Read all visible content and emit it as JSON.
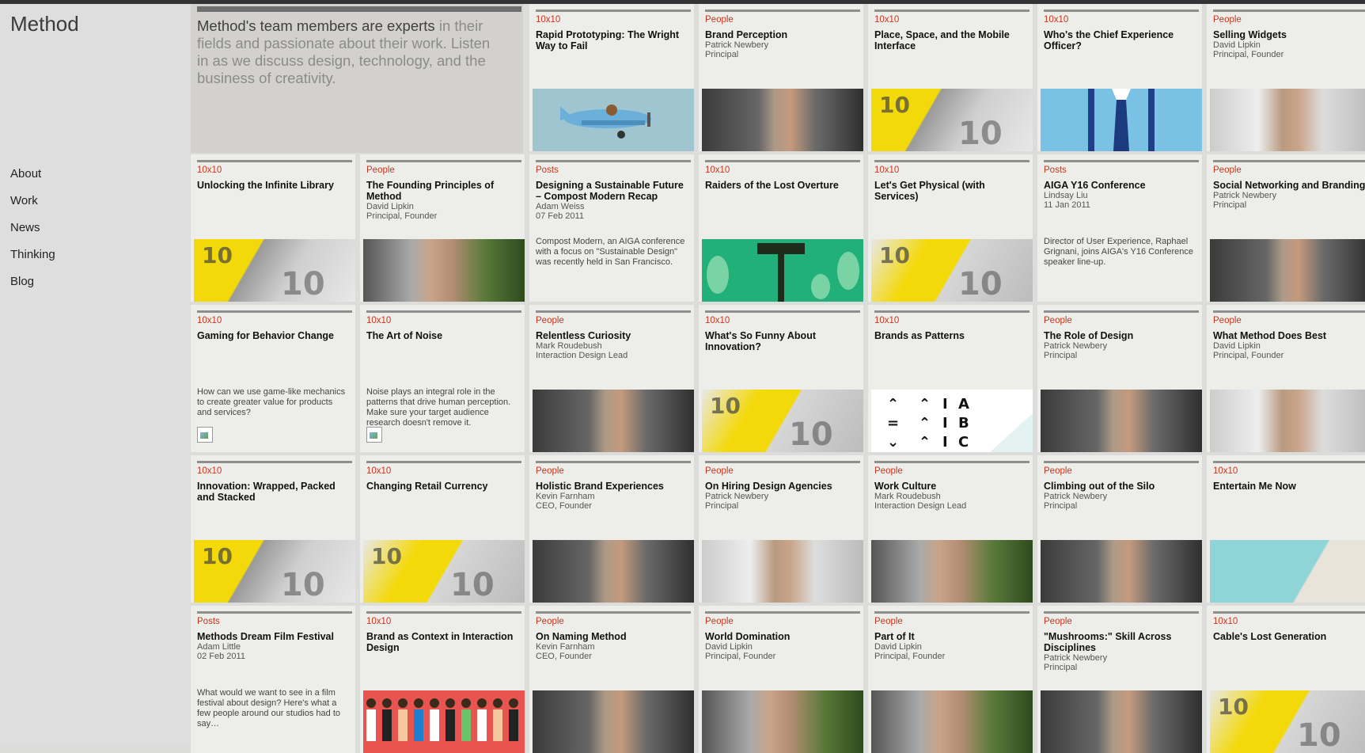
{
  "site": {
    "logo": "Method"
  },
  "nav": [
    {
      "label": "About"
    },
    {
      "label": "Work"
    },
    {
      "label": "News"
    },
    {
      "label": "Thinking"
    },
    {
      "label": "Blog"
    }
  ],
  "intro": {
    "strong": "Method's team members are experts",
    "rest": " in their fields and passionate about their work. Listen in as we discuss design, technology, and the business of creativity."
  },
  "tiles": [
    {
      "category": "10x10",
      "title": "Rapid Prototyping: The Wright Way to Fail",
      "thumb": "airplane"
    },
    {
      "category": "People",
      "title": "Brand Perception",
      "author": "Patrick Newbery",
      "role": "Principal",
      "thumb": "person"
    },
    {
      "category": "10x10",
      "title": "Place, Space, and the Mobile Interface",
      "thumb": "book"
    },
    {
      "category": "10x10",
      "title": "Who's the Chief Experience Officer?",
      "thumb": "shirt"
    },
    {
      "category": "People",
      "title": "Selling Widgets",
      "author": "David Lipkin",
      "role": "Principal, Founder",
      "thumb": "person2"
    },
    {
      "category": "10x10",
      "title": "Unlocking the Infinite Library",
      "thumb": "book"
    },
    {
      "category": "People",
      "title": "The Founding Principles of Method",
      "author": "David Lipkin",
      "role": "Principal, Founder",
      "thumb": "plant"
    },
    {
      "category": "Posts",
      "title": "Designing a Sustainable Future – Compost Modern Recap",
      "author": "Adam Weiss",
      "role": "07 Feb 2011",
      "desc": "Compost Modern, an AIGA conference with a focus on \"Sustainable Design\" was recently held in San Francisco."
    },
    {
      "category": "10x10",
      "title": "Raiders of the Lost Overture",
      "thumb": "green"
    },
    {
      "category": "10x10",
      "title": "Let's Get Physical (with Services)",
      "thumb": "book2"
    },
    {
      "category": "Posts",
      "title": "AIGA Y16 Conference",
      "author": "Lindsay Liu",
      "role": "11 Jan 2011",
      "desc": "Director of User Experience, Raphael Grignani, joins AIGA's Y16 Conference speaker line-up."
    },
    {
      "category": "People",
      "title": "Social Networking and Branding",
      "author": "Patrick Newbery",
      "role": "Principal",
      "thumb": "person"
    },
    {
      "category": "10x10",
      "title": "Gaming for Behavior Change",
      "desc": "How can we use game-like mechanics to create greater value for products and services?",
      "broken": true
    },
    {
      "category": "10x10",
      "title": "The Art of Noise",
      "desc": "Noise plays an integral role in the patterns that drive human perception. Make sure your target audience research doesn't remove it.",
      "broken": true
    },
    {
      "category": "People",
      "title": "Relentless Curiosity",
      "author": "Mark Roudebush",
      "role": "Interaction Design Lead",
      "thumb": "person"
    },
    {
      "category": "10x10",
      "title": "What's So Funny About Innovation?",
      "thumb": "book2"
    },
    {
      "category": "10x10",
      "title": "Brands as Patterns",
      "thumb": "pattern"
    },
    {
      "category": "People",
      "title": "The Role of Design",
      "author": "Patrick Newbery",
      "role": "Principal",
      "thumb": "person"
    },
    {
      "category": "People",
      "title": "What Method Does Best",
      "author": "David Lipkin",
      "role": "Principal, Founder",
      "thumb": "person2"
    },
    {
      "category": "10x10",
      "title": "Innovation: Wrapped, Packed and Stacked",
      "thumb": "book"
    },
    {
      "category": "10x10",
      "title": "Changing Retail Currency",
      "thumb": "book2"
    },
    {
      "category": "People",
      "title": "Holistic Brand Experiences",
      "author": "Kevin Farnham",
      "role": "CEO, Founder",
      "thumb": "person"
    },
    {
      "category": "People",
      "title": "On Hiring Design Agencies",
      "author": "Patrick Newbery",
      "role": "Principal",
      "thumb": "person2"
    },
    {
      "category": "People",
      "title": "Work Culture",
      "author": "Mark Roudebush",
      "role": "Interaction Design Lead",
      "thumb": "plant"
    },
    {
      "category": "People",
      "title": "Climbing out of the Silo",
      "author": "Patrick Newbery",
      "role": "Principal",
      "thumb": "person"
    },
    {
      "category": "10x10",
      "title": "Entertain Me Now",
      "thumb": "teal"
    },
    {
      "category": "Posts",
      "title": "Methods Dream Film Festival",
      "author": "Adam Little",
      "role": "02 Feb 2011",
      "desc": "What would we want to see in a film festival about design? Here's what a few people around our studios had to say…"
    },
    {
      "category": "10x10",
      "title": "Brand as Context in Interaction Design",
      "thumb": "red"
    },
    {
      "category": "People",
      "title": "On Naming Method",
      "author": "Kevin Farnham",
      "role": "CEO, Founder",
      "thumb": "person"
    },
    {
      "category": "People",
      "title": "World Domination",
      "author": "David Lipkin",
      "role": "Principal, Founder",
      "thumb": "plant"
    },
    {
      "category": "People",
      "title": "Part of It",
      "author": "David Lipkin",
      "role": "Principal, Founder",
      "thumb": "plant"
    },
    {
      "category": "People",
      "title": "\"Mushrooms:\" Skill Across Disciplines",
      "author": "Patrick Newbery",
      "role": "Principal",
      "thumb": "person"
    },
    {
      "category": "10x10",
      "title": "Cable's Lost Generation",
      "thumb": "book2"
    }
  ]
}
